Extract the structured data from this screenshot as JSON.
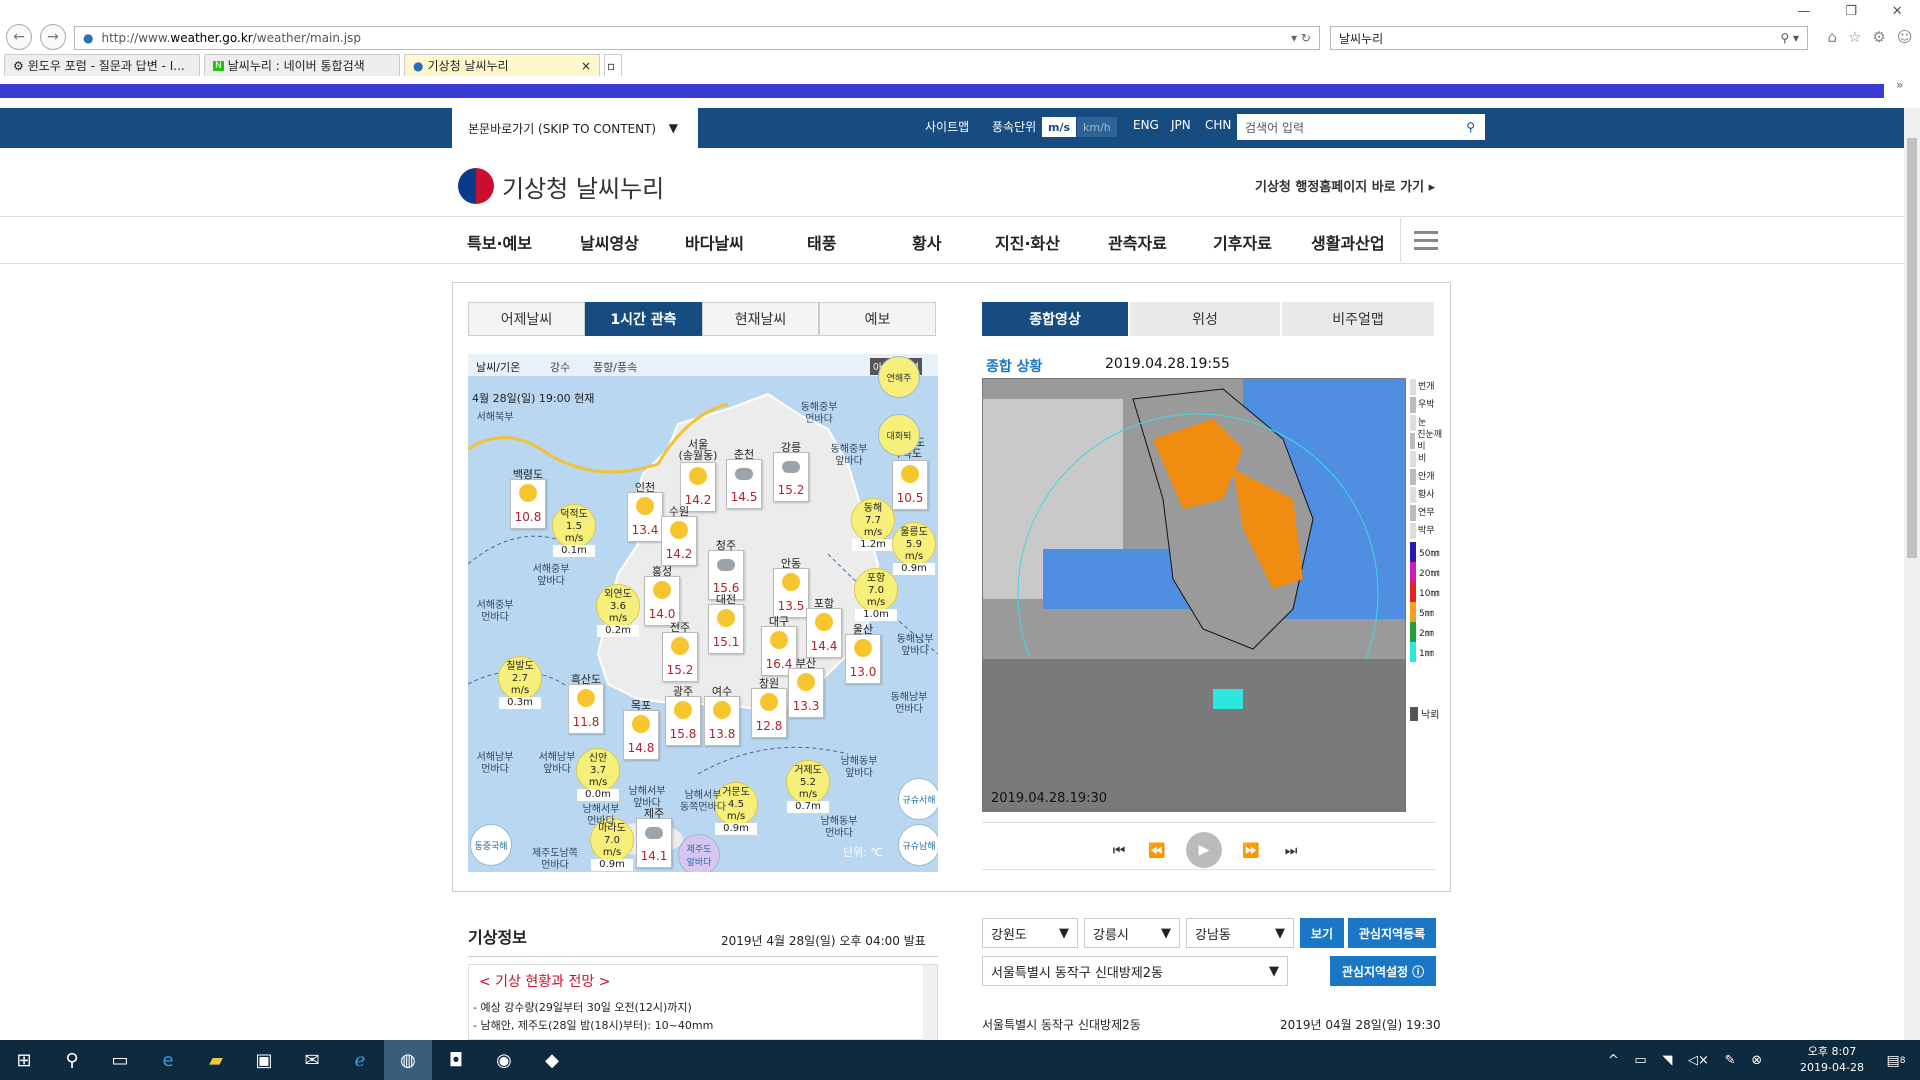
{
  "browser": {
    "url_prefix": "http://www.",
    "url_domain": "weather.go.kr",
    "url_path": "/weather/main.jsp",
    "search_value": "날씨누리",
    "tabs": [
      {
        "label": "윈도우 포럼 - 질문과 답변 - I..."
      },
      {
        "label": "날씨누리 : 네이버 통합검색"
      },
      {
        "label": "기상청 날씨누리"
      }
    ],
    "tab_close": "×"
  },
  "topbar": {
    "skip": "본문바로가기 (SKIP TO CONTENT)",
    "sitemap": "사이트맵",
    "wind_unit_label": "풍속단위",
    "unit_ms": "m/s",
    "unit_kmh": "km/h",
    "langs": [
      "ENG",
      "JPN",
      "CHN"
    ],
    "search_placeholder": "검색어 입력"
  },
  "header": {
    "logo_text": "기상청 날씨누리",
    "admin_link": "기상청 행정홈페이지 바로 가기 ▸"
  },
  "gnb": [
    "특보·예보",
    "날씨영상",
    "바다날씨",
    "태풍",
    "황사",
    "지진·화산",
    "관측자료",
    "기후자료",
    "생활과산업"
  ],
  "obs": {
    "tabs": [
      "어제날씨",
      "1시간 관측",
      "현재날씨",
      "예보"
    ],
    "subtabs": [
      "날씨/기온",
      "강수",
      "풍향/풍속"
    ],
    "icon_help": "아이콘설명",
    "timestamp": "4월 28일(일) 19:00 현재",
    "unit": "단위: ℃",
    "cities": [
      {
        "name": "백령도",
        "temp": "10.8",
        "icon": "sun"
      },
      {
        "name": "인천",
        "temp": "13.4",
        "icon": "sun"
      },
      {
        "name": "서울\n(송월동)",
        "temp": "14.2",
        "icon": "sun"
      },
      {
        "name": "춘천",
        "temp": "14.5",
        "icon": "cloud"
      },
      {
        "name": "강릉",
        "temp": "15.2",
        "icon": "cloud"
      },
      {
        "name": "수원",
        "temp": "14.2",
        "icon": "sun"
      },
      {
        "name": "청주",
        "temp": "15.6",
        "icon": "cloud"
      },
      {
        "name": "홍성",
        "temp": "14.0",
        "icon": "sun"
      },
      {
        "name": "안동",
        "temp": "13.5",
        "icon": "sun"
      },
      {
        "name": "대전",
        "temp": "15.1",
        "icon": "sun"
      },
      {
        "name": "포항",
        "temp": "14.4",
        "icon": "sun"
      },
      {
        "name": "울산",
        "temp": "13.0",
        "icon": "sun"
      },
      {
        "name": "전주",
        "temp": "15.2",
        "icon": "sun"
      },
      {
        "name": "대구",
        "temp": "16.4",
        "icon": "sun"
      },
      {
        "name": "흑산도",
        "temp": "11.8",
        "icon": "sun"
      },
      {
        "name": "목포",
        "temp": "14.8",
        "icon": "sun"
      },
      {
        "name": "광주",
        "temp": "15.8",
        "icon": "sun"
      },
      {
        "name": "여수",
        "temp": "13.8",
        "icon": "sun"
      },
      {
        "name": "창원",
        "temp": "12.8",
        "icon": "sun"
      },
      {
        "name": "부산",
        "temp": "13.3",
        "icon": "sun"
      },
      {
        "name": "제주",
        "temp": "14.1",
        "icon": "cloud"
      },
      {
        "name": "울릉도\n/독도",
        "temp": "10.5",
        "icon": "sun"
      }
    ],
    "buoys": [
      {
        "name": "덕적도",
        "wind": "1.5",
        "unit": "m/s",
        "wave": "0.1m"
      },
      {
        "name": "외연도",
        "wind": "3.6",
        "unit": "m/s",
        "wave": "0.2m"
      },
      {
        "name": "칠발도",
        "wind": "2.7",
        "unit": "m/s",
        "wave": "0.3m"
      },
      {
        "name": "신안",
        "wind": "3.7",
        "unit": "m/s",
        "wave": "0.0m"
      },
      {
        "name": "마라도",
        "wind": "7.0",
        "unit": "m/s",
        "wave": "0.9m"
      },
      {
        "name": "거문도",
        "wind": "4.5",
        "unit": "m/s",
        "wave": "0.9m"
      },
      {
        "name": "거제도",
        "wind": "5.2",
        "unit": "m/s",
        "wave": "0.7m"
      },
      {
        "name": "포항",
        "wind": "7.0",
        "unit": "m/s",
        "wave": "1.0m"
      },
      {
        "name": "동해",
        "wind": "7.7",
        "unit": "m/s",
        "wave": "1.2m"
      },
      {
        "name": "울릉도",
        "wind": "5.9",
        "unit": "m/s",
        "wave": "0.9m"
      }
    ],
    "seas": [
      "서해북부",
      "서해중부\n먼바다",
      "서해중부\n앞바다",
      "서해남부\n먼바다",
      "서해남부\n앞바다",
      "남해서부\n먼바다",
      "남해서부\n앞바다",
      "남해서부\n동쪽먼바다",
      "제주도남쪽\n먼바다",
      "동해중부\n먼바다",
      "동해중부\n앞바다",
      "동해남부\n앞바다",
      "동해남부\n먼바다",
      "남해동부\n먼바다",
      "남해동부\n앞바다"
    ],
    "circles": [
      "연해주",
      "대화퇴",
      "규슈서해",
      "규슈남해",
      "동중국해",
      "제주도\n앞바다"
    ]
  },
  "radar": {
    "tabs": [
      "종합영상",
      "위성",
      "비주얼맵"
    ],
    "title": "종합 상황",
    "time": "2019.04.28.19:55",
    "stamp": "2019.04.28.19:30",
    "legend_top": [
      "번개",
      "우박",
      "눈",
      "진눈깨비",
      "비",
      "안개",
      "황사",
      "연무",
      "박무"
    ],
    "legend_rain": [
      "50㎜",
      "20㎜",
      "10㎜",
      "5㎜",
      "2㎜",
      "1㎜"
    ],
    "legend_rain_colors": [
      "#2a1bb4",
      "#c41db8",
      "#e0261d",
      "#f2a21f",
      "#1fa038",
      "#2ee6e0"
    ],
    "legend_bottom": "낙뢰",
    "controls": [
      "⏮",
      "⏪",
      "▶",
      "⏩",
      "⏭"
    ]
  },
  "info": {
    "title": "기상정보",
    "published": "2019년 4월 28일(일) 오후 04:00 발표",
    "heading": "< 기상 현황과 전망 >",
    "lines": [
      "- 예상 강수량(29일부터 30일 오전(12시)까지)",
      "- 남해안, 제주도(28일 밤(18시)부터): 10~40mm"
    ]
  },
  "region": {
    "selects": [
      "강원도",
      "강릉시",
      "강남동"
    ],
    "view_btn": "보기",
    "register_btn": "관심지역등록",
    "current": "서울특별시 동작구 신대방제2동",
    "settings_btn": "관심지역설정",
    "footer_place": "서울특별시 동작구 신대방제2동",
    "footer_time": "2019년 04월 28일(일) 19:30"
  },
  "taskbar": {
    "time": "오후 8:07",
    "date": "2019-04-28",
    "notif_count": "8"
  }
}
